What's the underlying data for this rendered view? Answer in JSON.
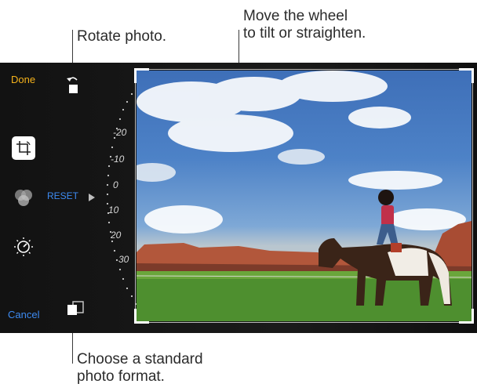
{
  "callouts": {
    "rotate": "Rotate photo.",
    "wheel": "Move the wheel\nto tilt or straighten.",
    "format": "Choose a standard\nphoto format."
  },
  "toolbar": {
    "done_label": "Done",
    "cancel_label": "Cancel",
    "reset_label": "RESET"
  },
  "wheel": {
    "ticks": [
      "-20",
      "-10",
      "0",
      "10",
      "20",
      "30"
    ]
  },
  "colors": {
    "accent_done": "#f5b21b",
    "accent_cancel": "#3d8bf2",
    "background": "#141414"
  },
  "icons": [
    "rotate-icon",
    "crop-icon",
    "filters-icon",
    "adjust-dial-icon",
    "aspect-ratio-icon",
    "reset-arrow-icon"
  ]
}
